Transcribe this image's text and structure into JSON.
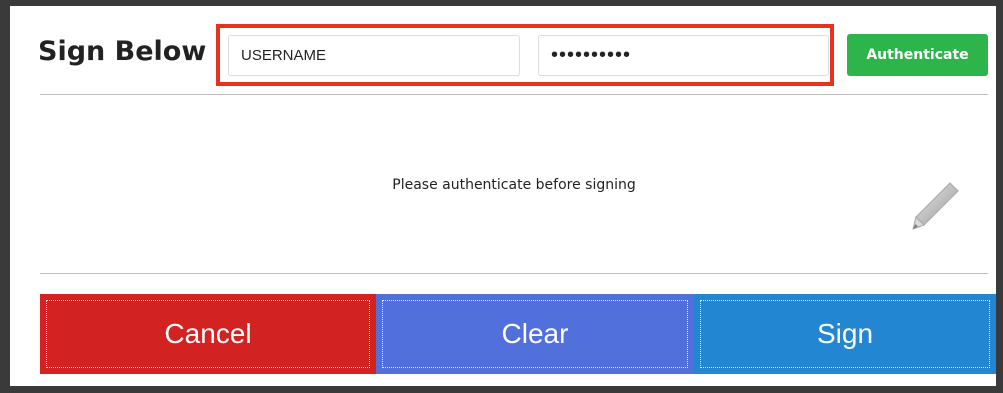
{
  "header": {
    "title": "Sign Below",
    "username_placeholder": "USERNAME",
    "password_value": "••••••••••",
    "authenticate_label": "Authenticate"
  },
  "signature": {
    "message": "Please authenticate before signing",
    "icon": "pencil-icon"
  },
  "actions": {
    "cancel_label": "Cancel",
    "clear_label": "Clear",
    "sign_label": "Sign"
  },
  "colors": {
    "highlight": "#e8321f",
    "authenticate": "#2db44a",
    "cancel": "#d22222",
    "clear": "#5170dc",
    "sign": "#2286d2"
  }
}
